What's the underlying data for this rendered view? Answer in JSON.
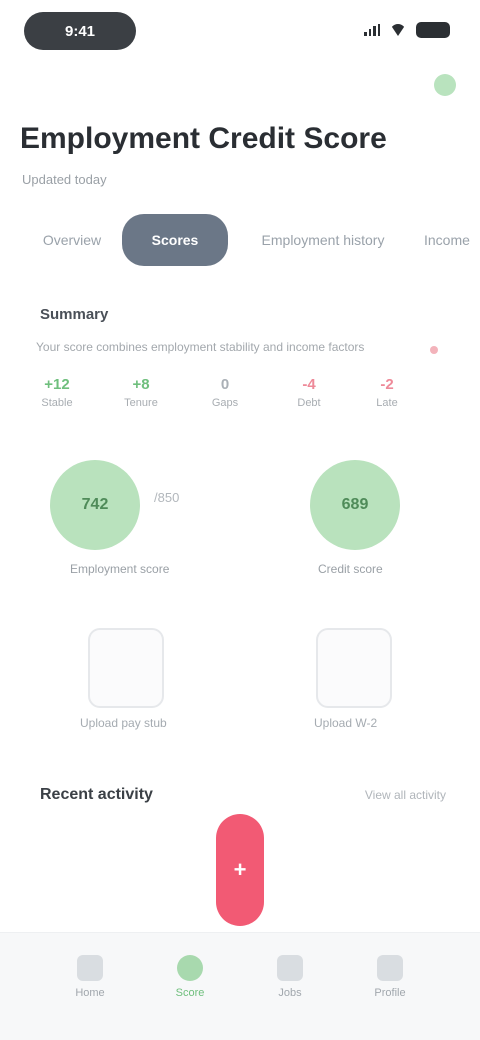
{
  "status_bar": {
    "time": "9:41",
    "icons": [
      "signal-icon",
      "wifi-icon",
      "battery-icon"
    ]
  },
  "header": {
    "title": "Employment Credit Score",
    "subtitle": "Updated today"
  },
  "tabs": [
    {
      "label": "Overview"
    },
    {
      "label": "Scores"
    },
    {
      "label": "Employment history"
    },
    {
      "label": "Income"
    }
  ],
  "summary": {
    "label": "Summary",
    "caption": "Your score combines employment stability and income factors",
    "stats": [
      {
        "value": "+12",
        "label": "Stable"
      },
      {
        "value": "+8",
        "label": "Tenure"
      },
      {
        "value": "0",
        "label": "Gaps"
      },
      {
        "value": "-4",
        "label": "Debt"
      },
      {
        "value": "-2",
        "label": "Late"
      }
    ]
  },
  "scores": {
    "left": {
      "value": "742",
      "side": "/850",
      "caption": "Employment score"
    },
    "right": {
      "value": "689",
      "caption": "Credit score"
    }
  },
  "documents": {
    "left_caption": "Upload pay stub",
    "right_caption": "Upload W-2"
  },
  "activity": {
    "title": "Recent activity",
    "link": "View all activity"
  },
  "fab": {
    "label": "+"
  },
  "bottom_nav": [
    {
      "label": "Home",
      "icon": "home-icon"
    },
    {
      "label": "Score",
      "icon": "chart-icon"
    },
    {
      "label": "Jobs",
      "icon": "briefcase-icon"
    },
    {
      "label": "Profile",
      "icon": "user-icon"
    }
  ],
  "colors": {
    "accent_green": "#6fbf7d",
    "active_tab": "#6b7787",
    "fab": "#f25a74"
  }
}
